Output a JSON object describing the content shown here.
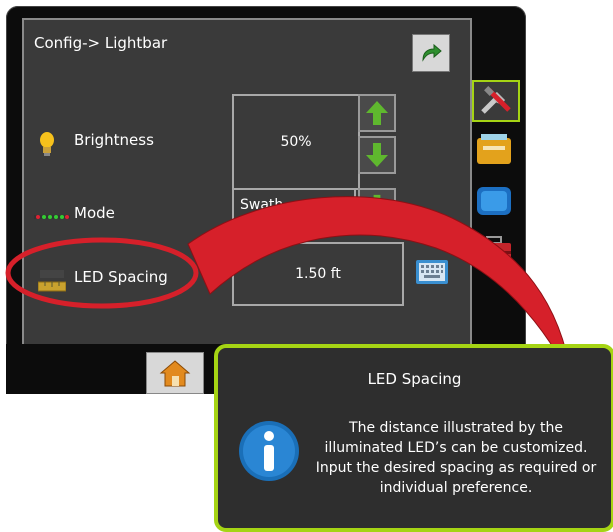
{
  "screen": {
    "title": "Config-> Lightbar",
    "rows": [
      {
        "label": "Brightness",
        "value": "50%"
      },
      {
        "label": "Mode",
        "value": "Swath"
      },
      {
        "label": "LED Spacing",
        "value": "1.50 ft"
      }
    ]
  },
  "side_tabs": [
    "tools-icon",
    "console-icon",
    "display-icon",
    "toolbox-icon"
  ],
  "callout": {
    "title": "LED Spacing",
    "body": "The distance illustrated by the illuminated LED’s can be customized. Input the desired spacing as required or individual preference."
  },
  "colors": {
    "accent": "#a5d414",
    "highlight": "#d6202a",
    "screen": "#3a3a3a",
    "arrow": "#5fb82e"
  }
}
